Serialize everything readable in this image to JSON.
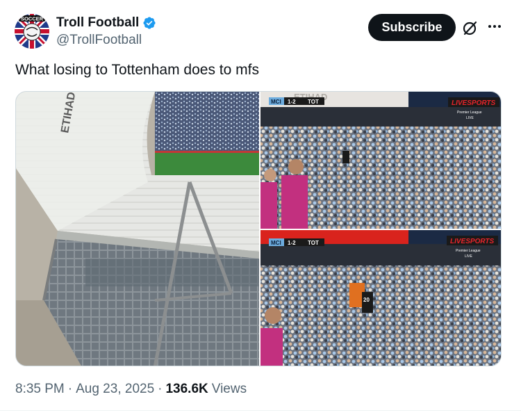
{
  "author": {
    "display_name": "Troll Football",
    "handle": "@TrollFootball",
    "avatar_text": "SOCCER"
  },
  "actions": {
    "subscribe_label": "Subscribe"
  },
  "tweet": {
    "text": "What losing to Tottenham does to mfs"
  },
  "media": {
    "left_image": {
      "stadium_text": "ETIHAD STADIUM"
    },
    "top_right": {
      "scoreboard": {
        "home": "MCI",
        "score": "1-2",
        "away": "TOT"
      },
      "broadcaster": "LIVESPORTS",
      "league": "Premier League",
      "status": "LIVE",
      "banner_text": "ETIHAD"
    },
    "bottom_right": {
      "scoreboard": {
        "home": "MCI",
        "score": "1-2",
        "away": "TOT"
      },
      "broadcaster": "LIVESPORTS",
      "league": "Premier League",
      "status": "LIVE",
      "shirt_number": "20"
    }
  },
  "meta": {
    "time": "8:35 PM",
    "separator1": "·",
    "date": "Aug 23, 2025",
    "separator2": "·",
    "views_count": "136.6K",
    "views_label": "Views"
  },
  "colors": {
    "text_primary": "#0f1419",
    "text_secondary": "#536471",
    "verified_blue": "#1d9bf0",
    "subscribe_bg": "#0f1419",
    "livesports_red": "#e8242a",
    "bib_pink": "#c2307f"
  }
}
